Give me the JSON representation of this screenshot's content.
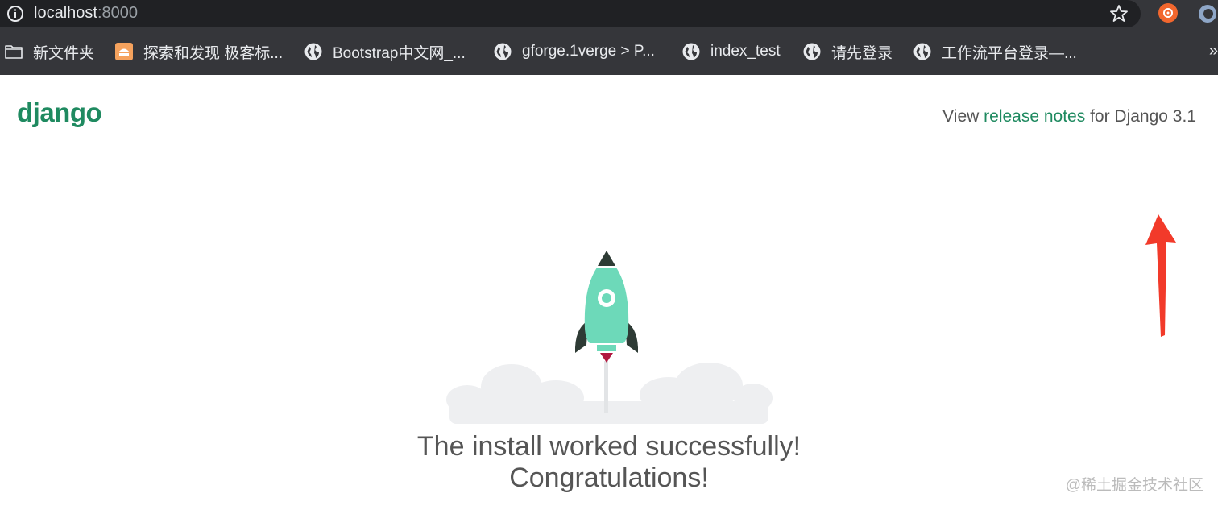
{
  "browser": {
    "url_host": "localhost",
    "url_port": ":8000",
    "bookmarks": [
      {
        "label": "新文件夹",
        "icon": "folder-icon"
      },
      {
        "label": "探索和发现 极客标...",
        "icon": "site-logo-icon"
      },
      {
        "label": "Bootstrap中文网_...",
        "icon": "globe-icon"
      },
      {
        "label": "gforge.1verge > P...",
        "icon": "globe-icon"
      },
      {
        "label": "index_test",
        "icon": "globe-icon"
      },
      {
        "label": "请先登录",
        "icon": "globe-icon"
      },
      {
        "label": "工作流平台登录—...",
        "icon": "globe-icon"
      }
    ],
    "more_bookmarks": "»"
  },
  "page": {
    "logo": "django",
    "release_prefix": "View",
    "release_link": "release notes",
    "release_suffix": "for Django 3.1",
    "headline_line1": "The install worked successfully!",
    "headline_line2": "Congratulations!",
    "watermark": "@稀土掘金技术社区"
  },
  "colors": {
    "django_green": "#1f8a60",
    "rocket_body": "#6dd9b9",
    "annotation_arrow": "#f23a2a"
  }
}
